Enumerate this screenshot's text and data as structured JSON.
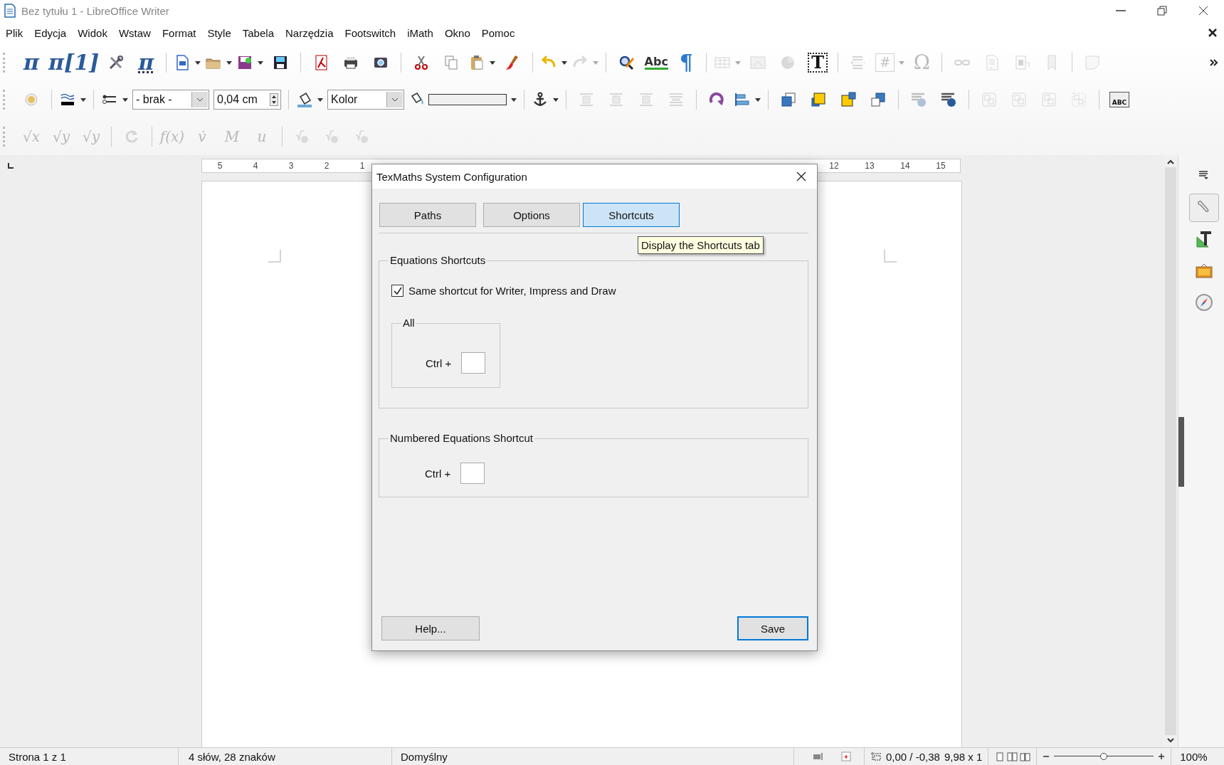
{
  "window": {
    "title": "Bez tytułu 1 - LibreOffice Writer"
  },
  "menu": [
    "Plik",
    "Edycja",
    "Widok",
    "Wstaw",
    "Format",
    "Style",
    "Tabela",
    "Narzędzia",
    "Footswitch",
    "iMath",
    "Okno",
    "Pomoc"
  ],
  "toolbars": [
    [
      {
        "kind": "glyph-pi",
        "glyph": "π",
        "disabled": false,
        "dropdown": false
      },
      {
        "kind": "glyph-pi",
        "glyph": "π[1]",
        "disabled": false,
        "dropdown": false
      },
      {
        "kind": "tools",
        "disabled": false,
        "dropdown": false
      },
      {
        "kind": "glyph-pi-gear",
        "glyph": "π",
        "disabled": false,
        "dropdown": false
      },
      {
        "kind": "separator"
      },
      {
        "kind": "new-doc",
        "disabled": false,
        "dropdown": true
      },
      {
        "kind": "folder",
        "disabled": false,
        "dropdown": true
      },
      {
        "kind": "save-as",
        "disabled": false,
        "dropdown": true
      },
      {
        "kind": "save",
        "disabled": false,
        "dropdown": false
      },
      {
        "kind": "separator"
      },
      {
        "kind": "pdf",
        "disabled": false,
        "dropdown": false
      },
      {
        "kind": "printer",
        "disabled": false,
        "dropdown": false
      },
      {
        "kind": "preview",
        "disabled": false,
        "dropdown": false
      },
      {
        "kind": "separator"
      },
      {
        "kind": "scissors",
        "disabled": false,
        "dropdown": false
      },
      {
        "kind": "copy",
        "disabled": false,
        "dropdown": false
      },
      {
        "kind": "paste",
        "disabled": false,
        "dropdown": true
      },
      {
        "kind": "brush",
        "disabled": false,
        "dropdown": false
      },
      {
        "kind": "separator"
      },
      {
        "kind": "undo",
        "disabled": false,
        "dropdown": true
      },
      {
        "kind": "redo",
        "disabled": true,
        "dropdown": true
      },
      {
        "kind": "separator"
      },
      {
        "kind": "find",
        "disabled": false,
        "dropdown": false
      },
      {
        "kind": "glyph-abc",
        "glyph": "Abc",
        "disabled": false,
        "dropdown": false
      },
      {
        "kind": "glyph-pilcrow",
        "glyph": "¶",
        "disabled": false,
        "dropdown": false
      },
      {
        "kind": "separator"
      },
      {
        "kind": "table",
        "disabled": true,
        "dropdown": true
      },
      {
        "kind": "image",
        "disabled": true,
        "dropdown": false
      },
      {
        "kind": "chart",
        "disabled": true,
        "dropdown": false
      },
      {
        "kind": "glyph-textbox",
        "glyph": "T",
        "disabled": false,
        "dropdown": false
      },
      {
        "kind": "separator"
      },
      {
        "kind": "page-break",
        "disabled": true,
        "dropdown": false
      },
      {
        "kind": "glyph-field",
        "glyph": "#",
        "disabled": true,
        "dropdown": true
      },
      {
        "kind": "glyph-omega",
        "glyph": "Ω",
        "disabled": true,
        "dropdown": false
      },
      {
        "kind": "separator"
      },
      {
        "kind": "hyperlink",
        "disabled": true,
        "dropdown": false
      },
      {
        "kind": "footnote",
        "disabled": true,
        "dropdown": false
      },
      {
        "kind": "endnote",
        "disabled": true,
        "dropdown": false
      },
      {
        "kind": "bookmark",
        "disabled": true,
        "dropdown": false
      },
      {
        "kind": "separator"
      },
      {
        "kind": "note",
        "disabled": true,
        "dropdown": false
      }
    ],
    [
      {
        "kind": "round-button",
        "disabled": false,
        "dropdown": false
      },
      {
        "kind": "separator"
      },
      {
        "kind": "line-style",
        "disabled": false,
        "dropdown": true
      },
      {
        "kind": "separator"
      },
      {
        "kind": "arrow-style",
        "disabled": false,
        "dropdown": true
      },
      {
        "kind": "combo",
        "value": "- brak -"
      },
      {
        "kind": "spin",
        "value": "0,04 cm"
      },
      {
        "kind": "separator"
      },
      {
        "kind": "fill-bucket",
        "disabled": false,
        "dropdown": true
      },
      {
        "kind": "combo",
        "value": "Kolor"
      },
      {
        "kind": "color-bar",
        "disabled": false,
        "dropdown": true
      },
      {
        "kind": "separator"
      },
      {
        "kind": "anchor",
        "disabled": false,
        "dropdown": true
      },
      {
        "kind": "separator"
      },
      {
        "kind": "wrap",
        "disabled": true,
        "dropdown": false
      },
      {
        "kind": "wrap",
        "disabled": true,
        "dropdown": false
      },
      {
        "kind": "wrap",
        "disabled": true,
        "dropdown": false
      },
      {
        "kind": "wrap-lines",
        "disabled": true,
        "dropdown": false
      },
      {
        "kind": "separator"
      },
      {
        "kind": "rotate",
        "disabled": false,
        "dropdown": false
      },
      {
        "kind": "align",
        "disabled": false,
        "dropdown": true
      },
      {
        "kind": "separator"
      },
      {
        "kind": "bring-front",
        "disabled": false,
        "dropdown": false
      },
      {
        "kind": "forward",
        "disabled": false,
        "dropdown": false
      },
      {
        "kind": "backward",
        "disabled": false,
        "dropdown": false
      },
      {
        "kind": "send-back",
        "disabled": false,
        "dropdown": false
      },
      {
        "kind": "separator"
      },
      {
        "kind": "text-wrap",
        "disabled": true,
        "dropdown": false
      },
      {
        "kind": "text-wrap",
        "disabled": false,
        "dropdown": false
      },
      {
        "kind": "separator"
      },
      {
        "kind": "group",
        "disabled": true,
        "dropdown": false
      },
      {
        "kind": "group",
        "disabled": true,
        "dropdown": false
      },
      {
        "kind": "group",
        "disabled": true,
        "dropdown": false
      },
      {
        "kind": "ungroup",
        "disabled": true,
        "dropdown": false
      },
      {
        "kind": "separator"
      },
      {
        "kind": "glyph-frame",
        "glyph": "ABC",
        "disabled": false,
        "dropdown": false
      }
    ],
    [
      {
        "kind": "glyph-math",
        "glyph": "√x",
        "disabled": true,
        "dropdown": false
      },
      {
        "kind": "glyph-math",
        "glyph": "√y",
        "disabled": true,
        "dropdown": false
      },
      {
        "kind": "glyph-math",
        "glyph": "√y",
        "disabled": true,
        "dropdown": false
      },
      {
        "kind": "separator"
      },
      {
        "kind": "refresh",
        "disabled": true,
        "dropdown": false
      },
      {
        "kind": "separator"
      },
      {
        "kind": "glyph-math",
        "glyph": "f(x)",
        "disabled": true,
        "dropdown": false
      },
      {
        "kind": "glyph-math",
        "glyph": "v̇",
        "disabled": true,
        "dropdown": false
      },
      {
        "kind": "glyph-math",
        "glyph": "M",
        "disabled": true,
        "dropdown": false
      },
      {
        "kind": "glyph-math",
        "glyph": "u",
        "disabled": true,
        "dropdown": false
      },
      {
        "kind": "separator"
      },
      {
        "kind": "eq-tool",
        "disabled": true,
        "dropdown": false
      },
      {
        "kind": "eq-tool",
        "disabled": true,
        "dropdown": false
      },
      {
        "kind": "eq-tool",
        "disabled": true,
        "dropdown": false
      }
    ]
  ],
  "ruler": {
    "left_labels": [
      "5",
      "4",
      "3",
      "2",
      "1"
    ],
    "right_labels": [
      "12",
      "13",
      "14",
      "15"
    ]
  },
  "dialog": {
    "title": "TexMaths System Configuration",
    "tabs": [
      {
        "label": "Paths",
        "selected": false
      },
      {
        "label": "Options",
        "selected": false
      },
      {
        "label": "Shortcuts",
        "selected": true
      }
    ],
    "tooltip": "Display the Shortcuts tab",
    "equations_group": {
      "title": "Equations Shortcuts",
      "checkbox": {
        "label": "Same shortcut for Writer, Impress and Draw",
        "checked": true
      },
      "all_group": {
        "title": "All",
        "field_label": "Ctrl +"
      }
    },
    "numbered_group": {
      "title": "Numbered Equations Shortcut",
      "field_label": "Ctrl +"
    },
    "buttons": [
      {
        "label": "Help...",
        "focused": false
      },
      {
        "label": "Save",
        "focused": true
      }
    ]
  },
  "status_bar": {
    "page": "Strona 1 z 1",
    "words": "4 słów, 28 znaków",
    "page_style": "Domyślny",
    "position": "0,00 / -0,38",
    "size": "9,98 x 1",
    "zoom": "100%",
    "zoom_slider": {
      "level": 0.5
    }
  }
}
